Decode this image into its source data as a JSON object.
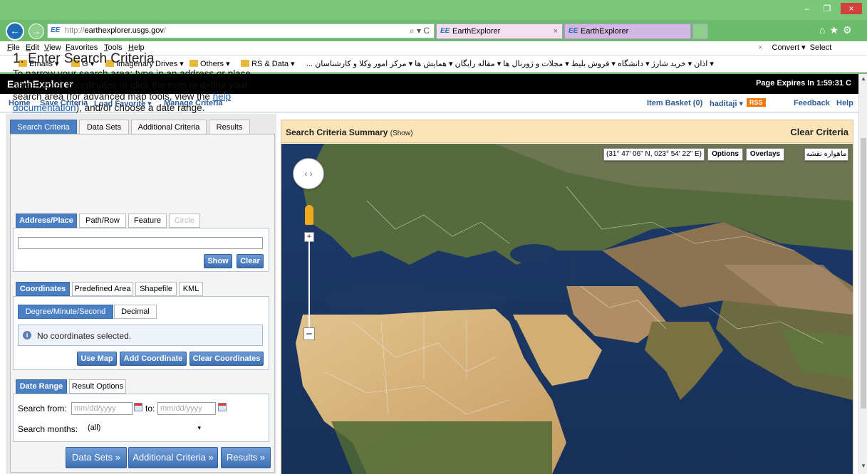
{
  "browser": {
    "url_prefix": "http://",
    "url_host": "earthexplorer.usgs.gov",
    "url_suffix": "/",
    "addr_icons": "⌕ ▾ C",
    "tab_icon": "EE",
    "tabs": [
      {
        "label": "EarthExplorer"
      },
      {
        "label": "EarthExplorer"
      }
    ],
    "tab_close": "×",
    "window": {
      "min": "–",
      "max": "❐",
      "close": "×"
    },
    "right_icons": "⌂★⚙",
    "menu": [
      "File",
      "Edit",
      "View",
      "Favorites",
      "Tools",
      "Help"
    ],
    "menu_right": {
      "close": "×",
      "convert": "Convert ▾",
      "select": "Select"
    },
    "favorites": [
      {
        "label": "Emails ▾"
      },
      {
        "label": "G ▾"
      },
      {
        "label": "Imagenary Drives ▾"
      },
      {
        "label": "Others ▾"
      },
      {
        "label": "RS & Data ▾"
      }
    ],
    "favorites_rtl": "▾ اذان  ▾ خرید شارژ  ▾ دانشگاه  ▾ فروش بلیط  ▾ مجلات و ژورنال ها  ▾ مقاله رایگان  ▾ همایش ها  ▾ مرکز امور وکلا و کارشناسان ..."
  },
  "app": {
    "title": "EarthExplorer",
    "expires": "Page Expires In 1:59:31  C",
    "toolbar": {
      "home": "Home",
      "save_criteria": "Save Criteria",
      "load_favorite": "Load Favorite ▾",
      "manage_criteria": "Manage Criteria",
      "item_basket": "Item Basket (0)",
      "user": "haditaji ▾",
      "rss": "RSS",
      "feedback": "Feedback",
      "help": "Help"
    }
  },
  "left": {
    "tabs": [
      "Search Criteria",
      "Data Sets",
      "Additional Criteria",
      "Results"
    ],
    "heading": "1. Enter Search Criteria",
    "instructions_before": "To narrow your search area: type in an address or place name, enter coordinates or click the map to define your search area (for advanced map tools, view the ",
    "instructions_link": "help documentation",
    "instructions_after": "), and/or choose a date range.",
    "area_tabs": [
      "Address/Place",
      "Path/Row",
      "Feature",
      "Circle"
    ],
    "show_btn": "Show",
    "clear_btn": "Clear",
    "coord_tabs": [
      "Coordinates",
      "Predefined Area",
      "Shapefile",
      "KML"
    ],
    "format_tabs": [
      "Degree/Minute/Second",
      "Decimal"
    ],
    "no_coords": "No coordinates selected.",
    "use_map": "Use Map",
    "add_coord": "Add Coordinate",
    "clear_coords": "Clear Coordinates",
    "date_tabs": [
      "Date Range",
      "Result Options"
    ],
    "search_from_label": "Search from:",
    "date_placeholder": "mm/dd/yyyy",
    "to_label": "to:",
    "search_months_label": "Search months:",
    "months_value": "(all)",
    "months_arrow": "▾",
    "nav_buttons": [
      "Data Sets »",
      "Additional Criteria »",
      "Results »"
    ]
  },
  "map": {
    "summary_title": "Search Criteria Summary",
    "summary_show": "(Show)",
    "clear_criteria": "Clear Criteria",
    "coord_readout": "(31° 47' 06\" N, 023° 54' 22\" E)",
    "options": "Options",
    "overlays": "Overlays",
    "map_type": "ماهواره  نقشه",
    "zoom_in": "+",
    "zoom_out": "−"
  }
}
